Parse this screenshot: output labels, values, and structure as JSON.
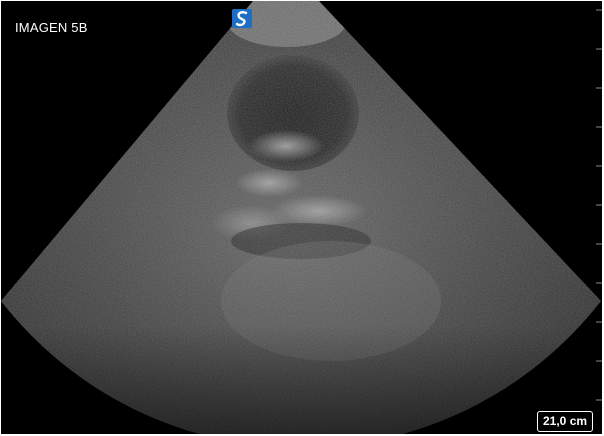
{
  "image_label": "IMAGEN 5B",
  "depth": {
    "value_text": "21,0 cm"
  },
  "colors": {
    "background": "#000000",
    "logo_blue": "#1e6fc4",
    "overlay_text": "#ffffff"
  },
  "icons": {
    "logo": "scanner-brand-logo-icon"
  }
}
